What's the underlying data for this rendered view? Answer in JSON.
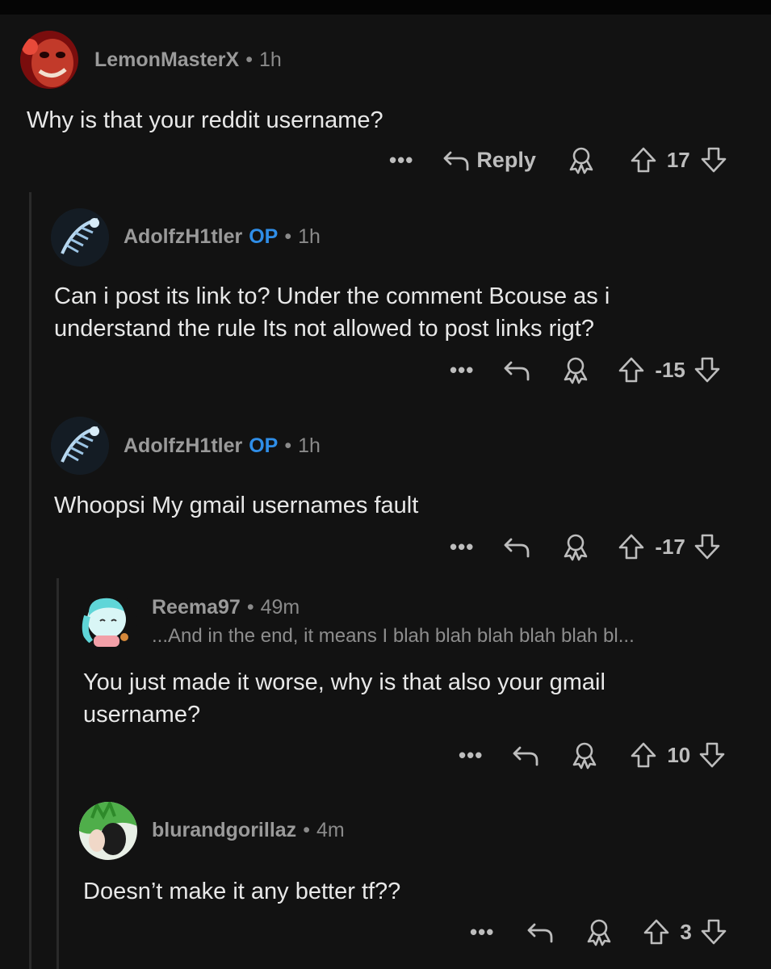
{
  "comments": [
    {
      "author": "LemonMasterX",
      "op_badge": "",
      "time": "1h",
      "flair": "",
      "body": "Why is that your reddit username?",
      "more": "•••",
      "reply_label": "Reply",
      "score": "17"
    },
    {
      "author": "AdolfzH1tler",
      "op_badge": "OP",
      "time": "1h",
      "flair": "",
      "body": "Can i post its link to? Under the comment Bcouse as i understand the rule Its not allowed to post links rigt?",
      "more": "•••",
      "reply_label": "",
      "score": "-15"
    },
    {
      "author": "AdolfzH1tler",
      "op_badge": "OP",
      "time": "1h",
      "flair": "",
      "body": "Whoopsi My gmail usernames fault",
      "more": "•••",
      "reply_label": "",
      "score": "-17"
    },
    {
      "author": "Reema97",
      "op_badge": "",
      "time": "49m",
      "flair": "...And in the end, it means I blah blah blah blah blah bl...",
      "body": "You just made it worse, why is that also your gmail username?",
      "more": "•••",
      "reply_label": "",
      "score": "10"
    },
    {
      "author": "blurandgorillaz",
      "op_badge": "",
      "time": "4m",
      "flair": "",
      "body": "Doesn’t make it any better tf??",
      "more": "•••",
      "reply_label": "",
      "score": "3"
    }
  ],
  "separator": "•",
  "icons": {
    "reply": "reply-arrow-icon",
    "award": "award-icon",
    "upvote": "upvote-arrow-icon",
    "downvote": "downvote-arrow-icon"
  },
  "colors": {
    "background": "#121212",
    "op": "#2f8ee8",
    "text": "#e8e8e8",
    "muted": "#9a9a9a"
  }
}
